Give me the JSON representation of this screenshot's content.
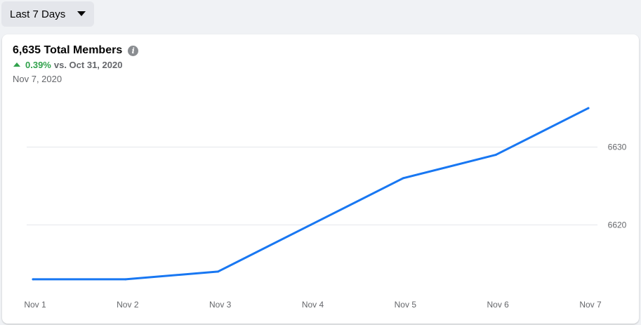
{
  "filter": {
    "label": "Last 7 Days"
  },
  "header": {
    "title": "6,635 Total Members",
    "change_pct": "0.39%",
    "change_vs": "vs. Oct 31, 2020",
    "date": "Nov 7, 2020"
  },
  "colors": {
    "line": "#1877f2",
    "positive": "#31a24c"
  },
  "chart_data": {
    "type": "line",
    "categories": [
      "Nov 1",
      "Nov 2",
      "Nov 3",
      "Nov 4",
      "Nov 5",
      "Nov 6",
      "Nov 7"
    ],
    "series": [
      {
        "values": [
          6613,
          6613,
          6614,
          6620,
          6626,
          6629,
          6635
        ]
      }
    ],
    "yticks": [
      6620,
      6630
    ],
    "ylim": [
      6612,
      6636
    ],
    "grid": true,
    "legend": "none"
  }
}
